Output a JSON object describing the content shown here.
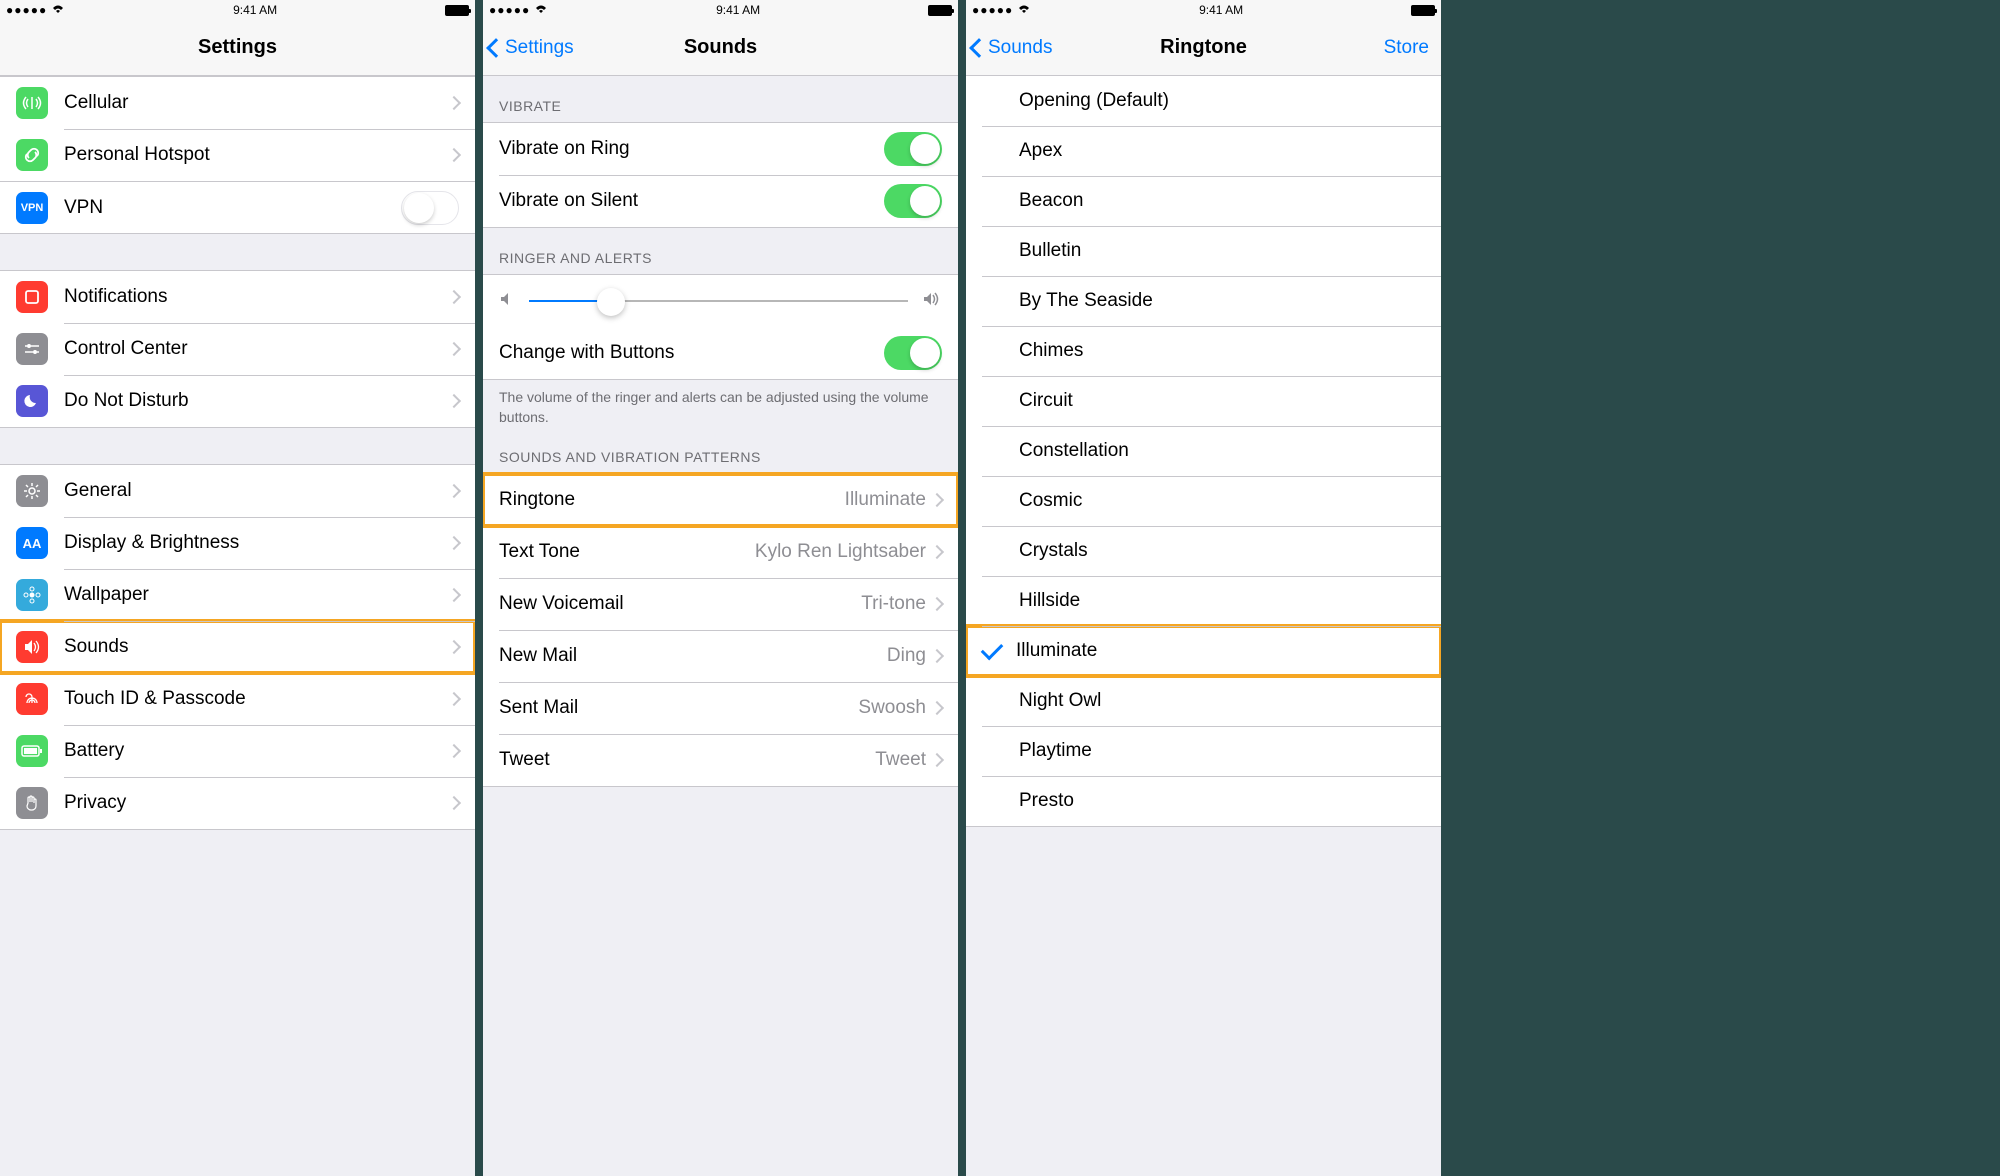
{
  "status": {
    "time": "9:41 AM"
  },
  "screen1": {
    "title": "Settings",
    "group1": [
      {
        "icon": "antenna",
        "color": "bg-green",
        "label": "Cellular"
      },
      {
        "icon": "link",
        "color": "bg-green",
        "label": "Personal Hotspot"
      }
    ],
    "vpn": {
      "label": "VPN",
      "badge": "VPN"
    },
    "group2": [
      {
        "icon": "square",
        "color": "bg-red",
        "label": "Notifications"
      },
      {
        "icon": "sliders",
        "color": "bg-gray",
        "label": "Control Center"
      },
      {
        "icon": "moon",
        "color": "bg-purple",
        "label": "Do Not Disturb"
      }
    ],
    "group3": [
      {
        "icon": "gear",
        "color": "bg-gray",
        "label": "General"
      },
      {
        "icon": "aa",
        "color": "bg-blue",
        "label": "Display & Brightness"
      },
      {
        "icon": "flower",
        "color": "bg-lightblue",
        "label": "Wallpaper"
      },
      {
        "icon": "speaker",
        "color": "bg-red",
        "label": "Sounds",
        "highlight": true
      },
      {
        "icon": "finger",
        "color": "bg-red",
        "label": "Touch ID & Passcode"
      },
      {
        "icon": "battery",
        "color": "bg-green",
        "label": "Battery"
      },
      {
        "icon": "hand",
        "color": "bg-gray",
        "label": "Privacy"
      }
    ]
  },
  "screen2": {
    "back": "Settings",
    "title": "Sounds",
    "sec_vibrate": "VIBRATE",
    "vibrate_ring": "Vibrate on Ring",
    "vibrate_silent": "Vibrate on Silent",
    "sec_ringer": "RINGER AND ALERTS",
    "change_buttons": "Change with Buttons",
    "footer": "The volume of the ringer and alerts can be adjusted using the volume buttons.",
    "sec_sounds": "SOUNDS AND VIBRATION PATTERNS",
    "rows": [
      {
        "label": "Ringtone",
        "value": "Illuminate",
        "highlight": true
      },
      {
        "label": "Text Tone",
        "value": "Kylo Ren Lightsaber"
      },
      {
        "label": "New Voicemail",
        "value": "Tri-tone"
      },
      {
        "label": "New Mail",
        "value": "Ding"
      },
      {
        "label": "Sent Mail",
        "value": "Swoosh"
      },
      {
        "label": "Tweet",
        "value": "Tweet"
      }
    ],
    "slider_value": 0.2
  },
  "screen3": {
    "back": "Sounds",
    "title": "Ringtone",
    "store": "Store",
    "tones": [
      {
        "label": "Opening (Default)"
      },
      {
        "label": "Apex"
      },
      {
        "label": "Beacon"
      },
      {
        "label": "Bulletin"
      },
      {
        "label": "By The Seaside"
      },
      {
        "label": "Chimes"
      },
      {
        "label": "Circuit"
      },
      {
        "label": "Constellation"
      },
      {
        "label": "Cosmic"
      },
      {
        "label": "Crystals"
      },
      {
        "label": "Hillside"
      },
      {
        "label": "Illuminate",
        "selected": true,
        "highlight": true
      },
      {
        "label": "Night Owl"
      },
      {
        "label": "Playtime"
      },
      {
        "label": "Presto"
      }
    ]
  }
}
